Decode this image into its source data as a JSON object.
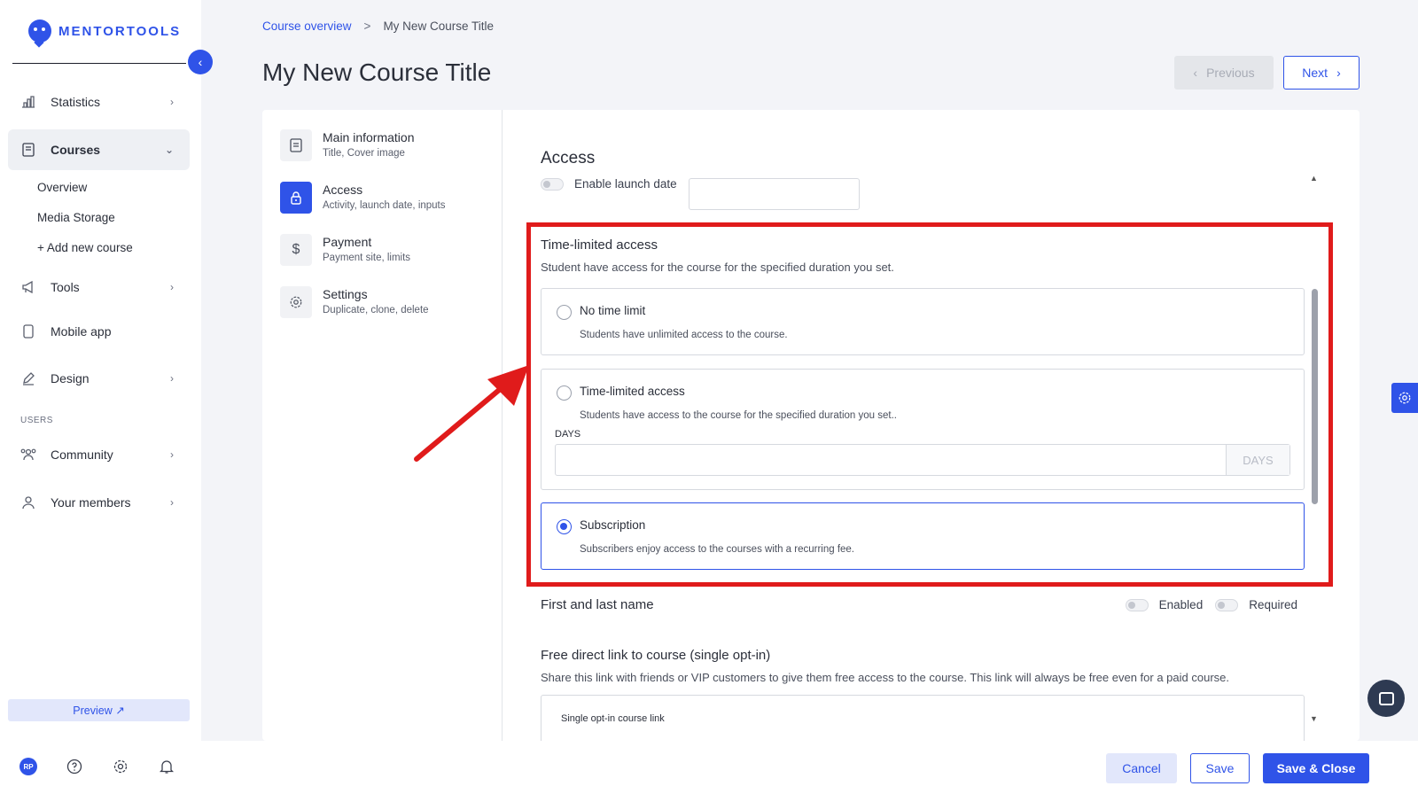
{
  "brand": {
    "name": "MENTORTOOLS"
  },
  "sidebar": {
    "items": [
      {
        "label": "Statistics"
      },
      {
        "label": "Courses"
      },
      {
        "label": "Tools"
      },
      {
        "label": "Mobile app"
      },
      {
        "label": "Design"
      },
      {
        "label": "Community"
      },
      {
        "label": "Your members"
      }
    ],
    "sub_items": [
      "Overview",
      "Media Storage",
      "+ Add new course"
    ],
    "section_users": "USERS",
    "preview_label": "Preview ↗",
    "avatar_initials": "RP"
  },
  "header": {
    "breadcrumb": {
      "link": "Course overview",
      "separator": ">",
      "current": "My New Course Title"
    },
    "title": "My New Course Title",
    "previous_label": "Previous",
    "next_label": "Next"
  },
  "steps": [
    {
      "title": "Main information",
      "subtitle": "Title, Cover image"
    },
    {
      "title": "Access",
      "subtitle": "Activity, launch date, inputs"
    },
    {
      "title": "Payment",
      "subtitle": "Payment site, limits"
    },
    {
      "title": "Settings",
      "subtitle": "Duplicate, clone, delete"
    }
  ],
  "access": {
    "title": "Access",
    "launch_label": "Enable launch date",
    "time_limited": {
      "title": "Time-limited access",
      "description": "Student have access for the course for the specified duration you set.",
      "options": [
        {
          "label": "No time limit",
          "description": "Students have unlimited access to the course."
        },
        {
          "label": "Time-limited access",
          "description": "Students have access to the course for the specified duration you set.."
        },
        {
          "label": "Subscription",
          "description": "Subscribers enjoy access to the courses with a recurring fee."
        }
      ],
      "days_label": "DAYS",
      "days_suffix": "DAYS",
      "selected": "Subscription"
    },
    "first_last": {
      "title": "First and last name",
      "enabled_label": "Enabled",
      "required_label": "Required"
    },
    "free_link": {
      "title": "Free direct link to course (single opt-in)",
      "description": "Share this link with friends or VIP customers to give them free access to the course. This link will always be free even for a paid course.",
      "box_label": "Single opt-in course link"
    }
  },
  "footer": {
    "cancel": "Cancel",
    "save": "Save",
    "save_close": "Save & Close"
  },
  "colors": {
    "accent": "#2f53e8",
    "highlight": "#e01b1b"
  }
}
